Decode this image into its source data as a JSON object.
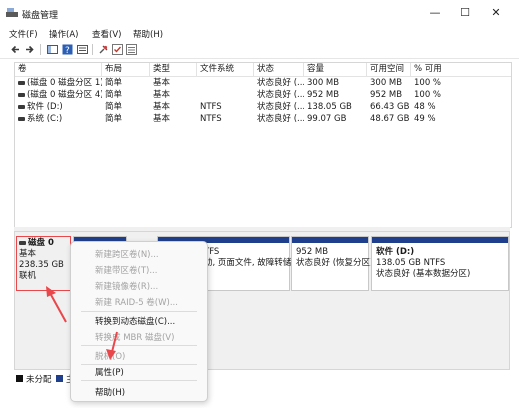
{
  "window": {
    "title": "磁盘管理",
    "controls": {
      "minimize": "—",
      "maximize": "☐",
      "close": "✕"
    }
  },
  "menubar": [
    "文件(F)",
    "操作(A)",
    "查看(V)",
    "帮助(H)"
  ],
  "toolbar_icons": [
    "back-icon",
    "forward-icon",
    "console-tree-icon",
    "help-icon",
    "properties-icon",
    "connect-icon",
    "check-icon",
    "list-icon"
  ],
  "volume_list": {
    "columns": [
      "卷",
      "布局",
      "类型",
      "文件系统",
      "状态",
      "容量",
      "可用空间",
      "% 可用"
    ],
    "rows": [
      [
        "(磁盘 0 磁盘分区 1)",
        "简单",
        "基本",
        "",
        "状态良好 (...",
        "300 MB",
        "300 MB",
        "100 %"
      ],
      [
        "(磁盘 0 磁盘分区 4)",
        "简单",
        "基本",
        "",
        "状态良好 (...",
        "952 MB",
        "952 MB",
        "100 %"
      ],
      [
        "软件 (D:)",
        "简单",
        "基本",
        "NTFS",
        "状态良好 (...",
        "138.05 GB",
        "66.43 GB",
        "48 %"
      ],
      [
        "系统 (C:)",
        "简单",
        "基本",
        "NTFS",
        "状态良好 (...",
        "99.07 GB",
        "48.67 GB",
        "49 %"
      ]
    ]
  },
  "disk_graph": {
    "disk": {
      "name": "磁盘 0",
      "type": "基本",
      "size": "238.35 GB",
      "status": "联机"
    },
    "partitions": [
      {
        "line1": "",
        "line2": "TFS",
        "line3": "动, 页面文件, 故障转储"
      },
      {
        "line1": "",
        "line2": "952 MB",
        "line3": "状态良好 (恢复分区)"
      },
      {
        "line1": "软件 (D:)",
        "line2": "138.05 GB NTFS",
        "line3": "状态良好 (基本数据分区)"
      }
    ]
  },
  "legend": {
    "unallocated": "未分配",
    "primary_partial": "主"
  },
  "context_menu": {
    "items": [
      {
        "label": "新建跨区卷(N)...",
        "enabled": false
      },
      {
        "label": "新建带区卷(T)...",
        "enabled": false
      },
      {
        "label": "新建镜像卷(R)...",
        "enabled": false
      },
      {
        "label": "新建 RAID-5 卷(W)...",
        "enabled": false
      },
      {
        "label": "转换到动态磁盘(C)...",
        "enabled": true
      },
      {
        "label": "转换成 MBR 磁盘(V)",
        "enabled": false
      },
      {
        "label": "脱机(O)",
        "enabled": false
      },
      {
        "label": "属性(P)",
        "enabled": true
      },
      {
        "label": "帮助(H)",
        "enabled": true
      }
    ]
  },
  "colors": {
    "partition_bar": "#1f3f8c",
    "highlight_outline": "#e8474b"
  }
}
